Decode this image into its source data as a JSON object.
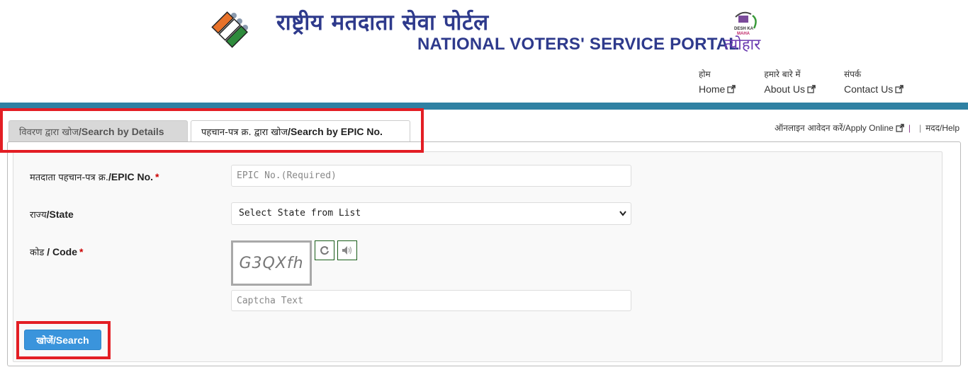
{
  "header": {
    "title_hindi": "राष्ट्रीय मतदाता सेवा पोर्टल",
    "title_english": "NATIONAL VOTERS' SERVICE PORTAL",
    "eci_logo_icon": "election-commission-logo",
    "campaign_logo_icon": "desh-ka-maha-tyohar-logo",
    "campaign_logo_text": "DESH KA MAHA त्योहार"
  },
  "nav": {
    "items": [
      {
        "label_hindi": "होम",
        "label_english": "Home",
        "icon": "external-link-icon"
      },
      {
        "label_hindi": "हमारे बारे में",
        "label_english": "About Us",
        "icon": "external-link-icon"
      },
      {
        "label_hindi": "संपर्क",
        "label_english": "Contact Us",
        "icon": "external-link-icon"
      }
    ]
  },
  "theme": {
    "accent_bar": "#2f81a3",
    "title_color": "#2e3a8c",
    "highlight": "#e31e24",
    "button_color": "#3a94dc"
  },
  "tabs": [
    {
      "label_hindi": "विवरण द्वारा खोज",
      "label_english": "/Search by Details",
      "active": false
    },
    {
      "label_hindi": "पहचान-पत्र क्र. द्वारा खोज",
      "label_english": "/Search by EPIC No.",
      "active": true
    }
  ],
  "top_links": {
    "apply_hindi": "ऑनलाइन आवेदन करें",
    "apply_english": "/Apply Online",
    "sep1": "|",
    "sep2": "|",
    "help_hindi": "मदद",
    "help_english": "/Help"
  },
  "form": {
    "epic": {
      "label_hindi": "मतदाता पहचान-पत्र क्र.",
      "label_english": "/EPIC No.",
      "required_mark": "*",
      "placeholder": "EPIC No.(Required)",
      "value": ""
    },
    "state": {
      "label_hindi": "राज्य",
      "label_english": "/State",
      "selected": "Select State from List"
    },
    "code": {
      "label_hindi": "कोड",
      "label_english": " / Code",
      "required_mark": "*",
      "captcha_text": "G3QXfh",
      "refresh_icon": "refresh-icon",
      "audio_icon": "speaker-icon",
      "placeholder": "Captcha Text",
      "value": ""
    },
    "search_button": {
      "label_hindi": "खोजें",
      "label_english": "/Search"
    }
  }
}
